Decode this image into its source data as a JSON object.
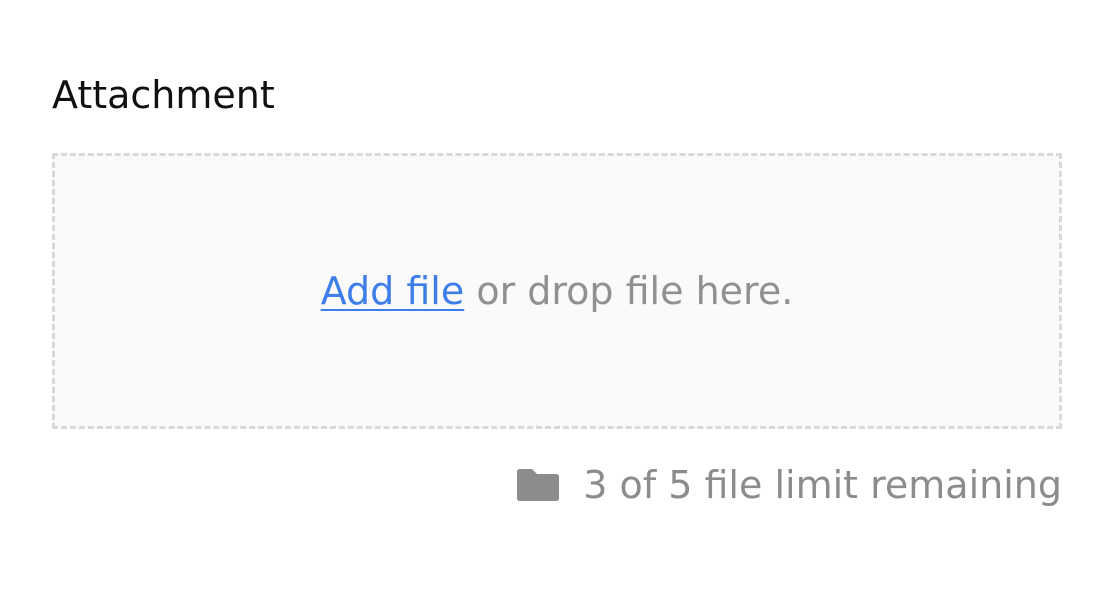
{
  "attachment": {
    "label": "Attachment",
    "dropzone": {
      "link_text": "Add file",
      "rest_text": " or drop file here."
    },
    "limit": {
      "icon": "folder-icon",
      "text": "3 of 5 file limit remaining"
    }
  },
  "colors": {
    "link": "#3d7ee8",
    "muted_text": "#8c8c8c",
    "dropzone_border": "#d9d9d9",
    "dropzone_bg": "#fafafa"
  }
}
